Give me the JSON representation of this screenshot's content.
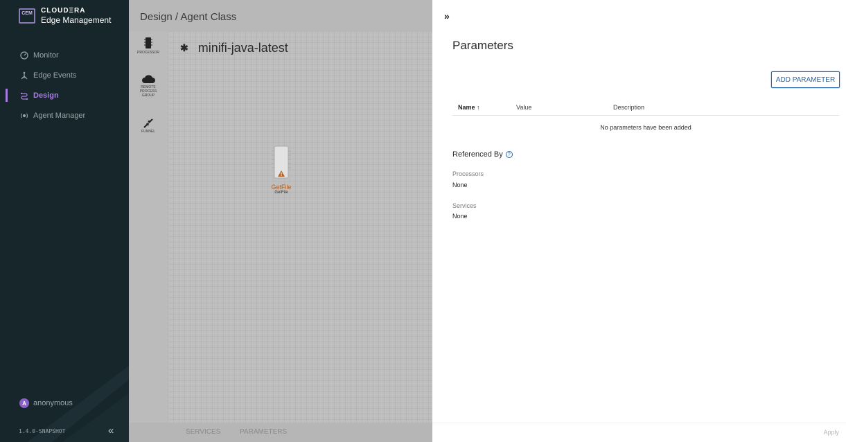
{
  "brand": {
    "logo_text": "CEM",
    "name": "CLOUDΞRA",
    "product": "Edge Management"
  },
  "nav": [
    {
      "label": "Monitor",
      "icon": "monitor-gauge-icon",
      "active": false
    },
    {
      "label": "Edge Events",
      "icon": "edge-events-icon",
      "active": false
    },
    {
      "label": "Design",
      "icon": "design-flow-icon",
      "active": true
    },
    {
      "label": "Agent Manager",
      "icon": "agent-manager-icon",
      "active": false
    }
  ],
  "user": {
    "initial": "A",
    "name": "anonymous"
  },
  "version": "1.4.0-SNAPSHOT",
  "designer": {
    "breadcrumb": "Design / Agent Class",
    "palette": {
      "processor": "PROCESSOR",
      "rpg_line1": "REMOTE",
      "rpg_line2": "PROCESS",
      "rpg_line3": "GROUP",
      "funnel": "FUNNEL"
    },
    "flow_marker": "✱",
    "flow_name": "minifi-java-latest",
    "processor": {
      "name": "GetFile",
      "type": "GetFile",
      "status": "warning"
    },
    "tabs": {
      "services": "SERVICES",
      "parameters": "PARAMETERS"
    }
  },
  "panel": {
    "collapse_glyph": "»",
    "title": "Parameters",
    "add_button": "ADD PARAMETER",
    "columns": {
      "name": "Name",
      "sort_arrow": "↑",
      "value": "Value",
      "description": "Description"
    },
    "empty_message": "No parameters have been added",
    "referenced_by": "Referenced By",
    "help_glyph": "?",
    "processors_label": "Processors",
    "processors_value": "None",
    "services_label": "Services",
    "services_value": "None",
    "apply": "Apply"
  },
  "colors": {
    "sidebar_bg": "#17262b",
    "accent_purple": "#a77ee0",
    "primary_blue": "#2565ad",
    "warning_orange": "#b0642a"
  }
}
